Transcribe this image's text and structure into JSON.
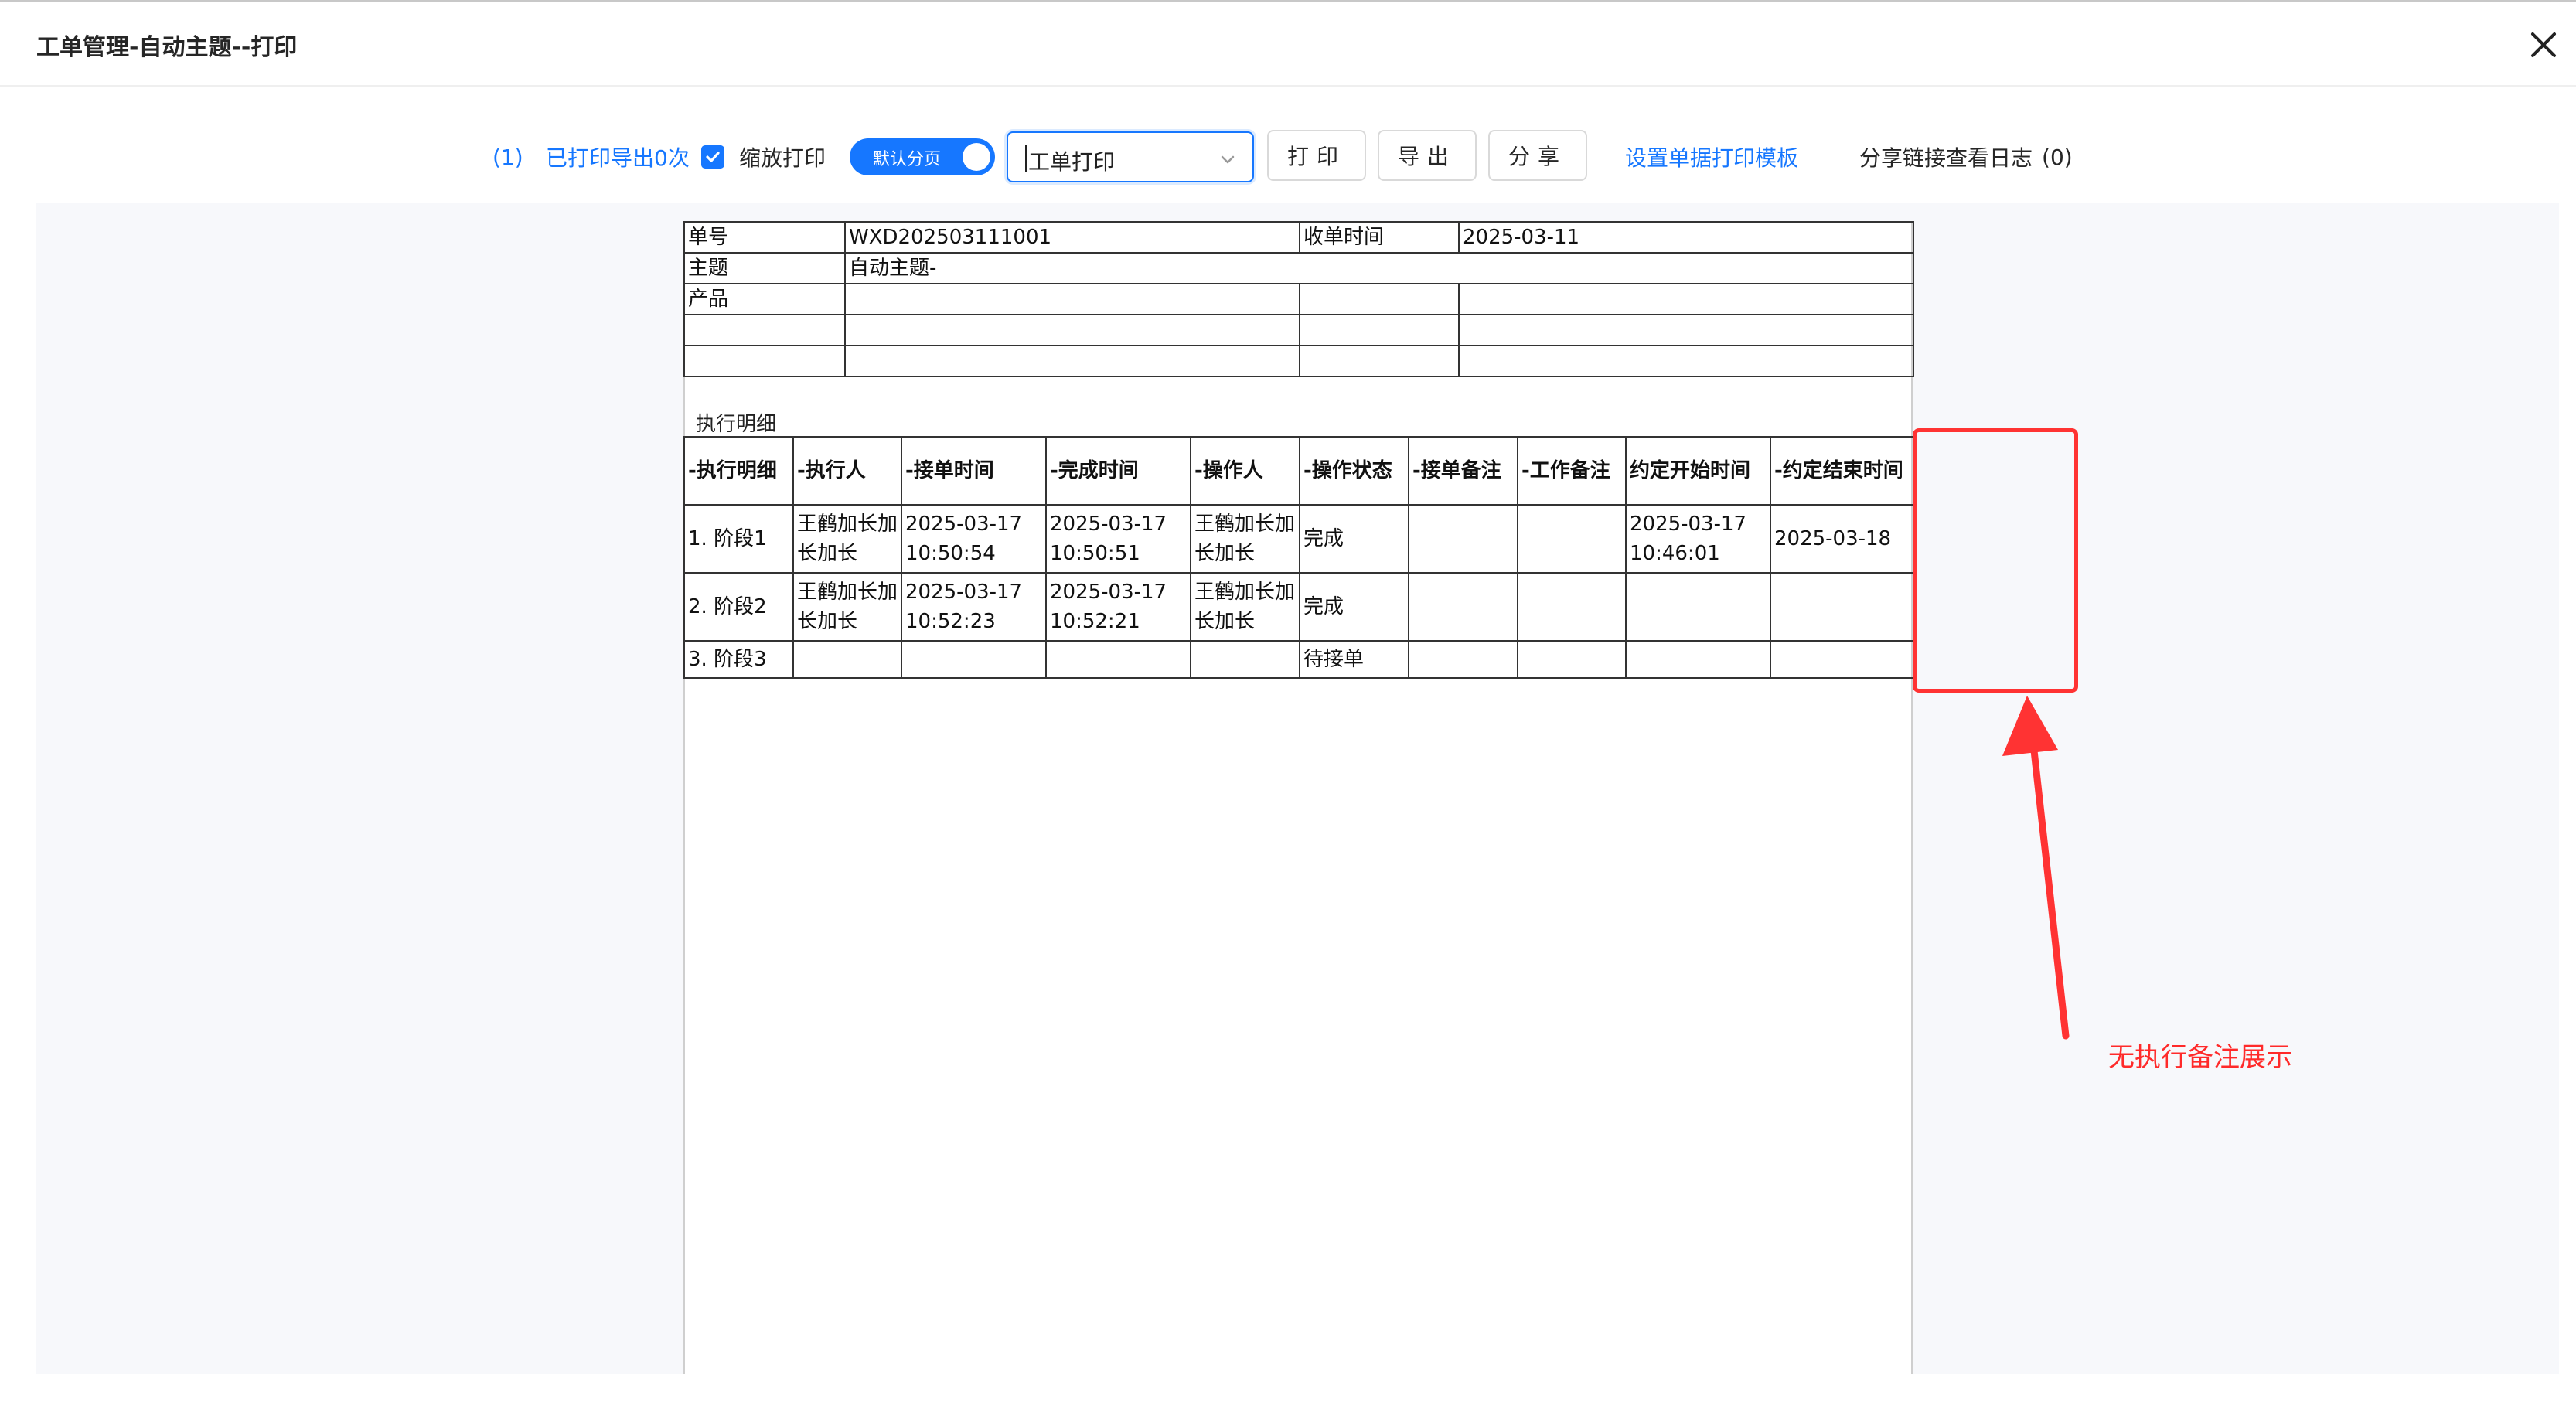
{
  "window": {
    "title": "工单管理-自动主题--打印"
  },
  "toolbar": {
    "count": "(1)",
    "printed_text": "已打印导出0次",
    "scale_print_label": "缩放打印",
    "scale_print_checked": true,
    "paging_label": "默认分页",
    "template_select_value": "工单打印",
    "print_label": "打印",
    "export_label": "导出",
    "share_label": "分享",
    "template_link": "设置单据打印模板",
    "share_log_label": "分享链接查看日志",
    "share_log_count": "(0)"
  },
  "info_table": {
    "order_no_label": "单号",
    "order_no_value": "WXD202503111001",
    "receive_time_label": "收单时间",
    "receive_time_value": "2025-03-11",
    "subject_label": "主题",
    "subject_value": "自动主题-",
    "product_label": "产品"
  },
  "detail": {
    "section_title": "执行明细",
    "columns": [
      "-执行明细",
      "-执行人",
      "-接单时间",
      "-完成时间",
      "-操作人",
      "-操作状态",
      "-接单备注",
      "-工作备注",
      "约定开始时间",
      "-约定结束时间"
    ],
    "rows": [
      [
        "1. 阶段1",
        "王鹤加长加长加长",
        "2025-03-17 10:50:54",
        "2025-03-17 10:50:51",
        "王鹤加长加长加长",
        "完成",
        "",
        "",
        "2025-03-17 10:46:01",
        "2025-03-18"
      ],
      [
        "2. 阶段2",
        "王鹤加长加长加长",
        "2025-03-17 10:52:23",
        "2025-03-17 10:52:21",
        "王鹤加长加长加长",
        "完成",
        "",
        "",
        "",
        ""
      ],
      [
        "3. 阶段3",
        "",
        "",
        "",
        "",
        "待接单",
        "",
        "",
        "",
        ""
      ]
    ]
  },
  "annotation": {
    "text": "无执行备注展示",
    "color": "#ff2a2a"
  },
  "colors": {
    "accent": "#1677ff",
    "annotation": "#ff3333"
  },
  "icons": {
    "close": "close-icon",
    "check": "check-icon",
    "dropdown": "chevron-down-icon"
  }
}
